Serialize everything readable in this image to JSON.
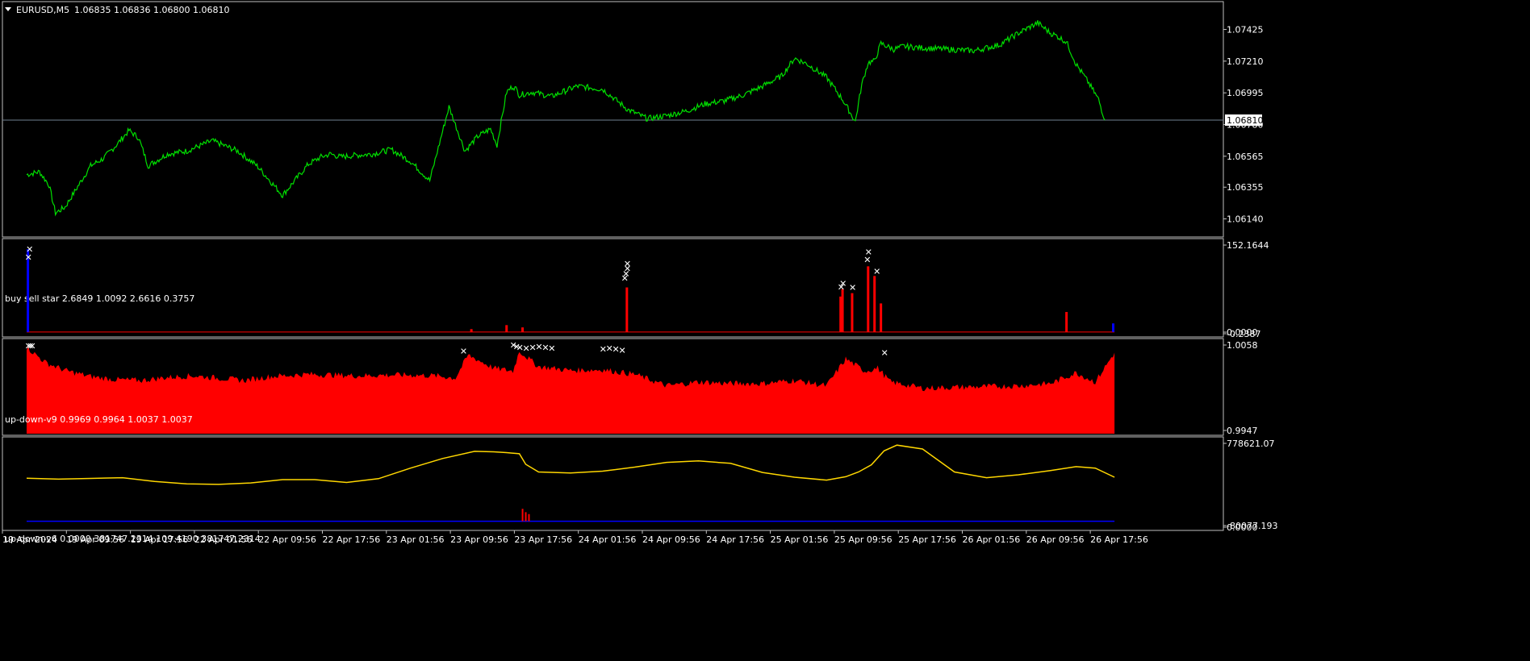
{
  "colors": {
    "background": "#000000",
    "border": "#c0c0c0",
    "text": "#ffffff",
    "price_line": "#00e000",
    "bid_line": "#708090",
    "buy": "#0000ff",
    "sell": "#ff0000",
    "marker": "#ffffff",
    "yellow_line": "#ffd700"
  },
  "icons": {
    "panel_toggle": "triangle-down-icon",
    "signal_marker": "cross-icon"
  },
  "chart_data": [
    {
      "type": "line",
      "title": "EURUSD,M5",
      "ohlc": [
        "1.06835",
        "1.06836",
        "1.06800",
        "1.06810"
      ],
      "last_price_label": "1.06810",
      "y_tick_labels": [
        "1.07425",
        "1.07210",
        "1.06995",
        "1.06780",
        "1.06565",
        "1.06355",
        "1.06140"
      ],
      "ylim": [
        1.0605,
        1.0757
      ],
      "x_tick_labels": [
        "19 Apr 2024",
        "19 Apr 09:56",
        "19 Apr 17:56",
        "22 Apr 01:56",
        "22 Apr 09:56",
        "22 Apr 17:56",
        "23 Apr 01:56",
        "23 Apr 09:56",
        "23 Apr 17:56",
        "24 Apr 01:56",
        "24 Apr 09:56",
        "24 Apr 17:56",
        "25 Apr 01:56",
        "25 Apr 09:56",
        "25 Apr 17:56",
        "26 Apr 01:56",
        "26 Apr 09:56",
        "26 Apr 17:56"
      ],
      "xlim": [
        0,
        17
      ],
      "series": [
        {
          "x": [
            0,
            0.2,
            0.35,
            0.45,
            0.6,
            0.8,
            1.0,
            1.2,
            1.4,
            1.6,
            1.75,
            1.9,
            2.05,
            2.2,
            2.5,
            2.9,
            3.3,
            3.6,
            4.0,
            4.4,
            4.6,
            4.75,
            4.9,
            5.1,
            5.4,
            5.7,
            6.0,
            6.3,
            6.6,
            6.85,
            6.95,
            7.05,
            7.25,
            7.35,
            7.5,
            7.6,
            7.65,
            7.7,
            7.9,
            8.2,
            8.6,
            9.0,
            9.4,
            9.7,
            10.0,
            10.3,
            10.6,
            10.9,
            11.2,
            11.5,
            11.8,
            12.0,
            12.2,
            12.5,
            12.75,
            12.95,
            13.05,
            13.15,
            13.25,
            13.35,
            13.55,
            13.7,
            14.0,
            14.4,
            14.8,
            15.2,
            15.5,
            15.8,
            16.0,
            16.1,
            16.25,
            16.4,
            16.6,
            16.75,
            16.85
          ],
          "values": [
            1.0644,
            1.0646,
            1.0637,
            1.0618,
            1.0622,
            1.0636,
            1.065,
            1.0655,
            1.0664,
            1.0674,
            1.0669,
            1.065,
            1.0654,
            1.0658,
            1.066,
            1.0667,
            1.066,
            1.065,
            1.063,
            1.0651,
            1.0656,
            1.0658,
            1.0656,
            1.0657,
            1.0658,
            1.0661,
            1.0653,
            1.064,
            1.069,
            1.066,
            1.0665,
            1.067,
            1.0675,
            1.0664,
            1.07,
            1.0704,
            1.0702,
            1.0698,
            1.07,
            1.0697,
            1.0704,
            1.0702,
            1.0688,
            1.0682,
            1.0684,
            1.0687,
            1.0692,
            1.0694,
            1.0698,
            1.0704,
            1.0711,
            1.0723,
            1.0719,
            1.071,
            1.0695,
            1.068,
            1.0705,
            1.072,
            1.0721,
            1.0733,
            1.0729,
            1.0731,
            1.073,
            1.0729,
            1.0728,
            1.0732,
            1.074,
            1.0747,
            1.074,
            1.0738,
            1.0734,
            1.0719,
            1.0706,
            1.0695,
            1.0681
          ]
        }
      ]
    },
    {
      "type": "bar",
      "title": "buy sell star",
      "values_text": [
        "2.6849",
        "1.0092",
        "2.6616",
        "0.3757"
      ],
      "y_tick_labels": [
        "152.1644",
        "0.0000",
        "-0.2387"
      ],
      "ylim": [
        -0.2387,
        152.1644
      ],
      "spikes": [
        {
          "x": 0.02,
          "value": 145,
          "side": "buy"
        },
        {
          "x": 6.95,
          "value": 5,
          "side": "sell"
        },
        {
          "x": 7.5,
          "value": 12,
          "side": "sell"
        },
        {
          "x": 7.75,
          "value": 8,
          "side": "sell"
        },
        {
          "x": 9.38,
          "value": 78,
          "side": "sell"
        },
        {
          "x": 12.72,
          "value": 62,
          "side": "sell"
        },
        {
          "x": 12.75,
          "value": 75,
          "side": "sell"
        },
        {
          "x": 12.9,
          "value": 68,
          "side": "sell"
        },
        {
          "x": 13.15,
          "value": 115,
          "side": "sell"
        },
        {
          "x": 13.25,
          "value": 98,
          "side": "sell"
        },
        {
          "x": 13.35,
          "value": 50,
          "side": "sell"
        },
        {
          "x": 16.25,
          "value": 35,
          "side": "sell"
        },
        {
          "x": 16.98,
          "value": 15,
          "side": "buy"
        }
      ],
      "markers": [
        {
          "x": 0.04,
          "value": 145
        },
        {
          "x": 0.02,
          "value": 131
        },
        {
          "x": 9.38,
          "value": 120
        },
        {
          "x": 9.38,
          "value": 111
        },
        {
          "x": 9.36,
          "value": 102
        },
        {
          "x": 9.34,
          "value": 94
        },
        {
          "x": 12.75,
          "value": 85
        },
        {
          "x": 12.72,
          "value": 79
        },
        {
          "x": 12.9,
          "value": 78
        },
        {
          "x": 13.15,
          "value": 140
        },
        {
          "x": 13.13,
          "value": 127
        },
        {
          "x": 13.28,
          "value": 106
        }
      ]
    },
    {
      "type": "area",
      "title": "up-down-v9",
      "values_text": [
        "0.9969",
        "0.9964",
        "1.0037",
        "1.0037"
      ],
      "y_tick_labels": [
        "1.0058",
        "0.9947"
      ],
      "ylim": [
        0.9947,
        1.0058
      ],
      "series": [
        {
          "name": "buy",
          "x": [
            0,
            0.3,
            0.6,
            1.0,
            1.4,
            1.8,
            2.2,
            2.6,
            3.0,
            3.4,
            3.8,
            4.4,
            4.8,
            5.2,
            5.6,
            6.0,
            6.4,
            6.7,
            6.9,
            7.3,
            7.6,
            7.7,
            8.0,
            8.5,
            9.0,
            9.5,
            10.0,
            10.5,
            11.0,
            11.5,
            12.0,
            12.5,
            12.8,
            13.1,
            13.3,
            13.5,
            14.0,
            14.5,
            15.0,
            15.5,
            16.0,
            16.4,
            16.7,
            17.0
          ],
          "values": [
            1.0055,
            1.0035,
            1.0025,
            1.0017,
            1.0013,
            1.001,
            1.0016,
            1.0018,
            1.0008,
            1.0008,
            1.001,
            1.002,
            1.001,
            1.0005,
            1.0004,
            1.0005,
            1.0004,
            1.0006,
            1.0045,
            1.0028,
            1.0024,
            1.005,
            1.003,
            1.0025,
            1.0026,
            1.002,
            1.0,
            1.0001,
            1.0004,
            1.0006,
            1.0005,
            1.0003,
            1.004,
            1.0024,
            1.0028,
            1.001,
            1.0002,
            1.0003,
            1.0004,
            1.0005,
            1.0008,
            1.0022,
            1.001,
            1.0048
          ]
        },
        {
          "name": "sell",
          "x": [
            0,
            0.3,
            0.6,
            1.0,
            1.4,
            1.8,
            2.2,
            2.6,
            3.0,
            3.4,
            3.8,
            4.4,
            4.8,
            5.2,
            5.6,
            6.0,
            6.4,
            6.7,
            6.9,
            7.3,
            7.6,
            7.7,
            8.0,
            8.5,
            9.0,
            9.5,
            10.0,
            10.5,
            11.0,
            11.5,
            12.0,
            12.5,
            12.8,
            13.1,
            13.3,
            13.5,
            14.0,
            14.5,
            15.0,
            15.5,
            16.0,
            16.4,
            16.7,
            17.0
          ],
          "values": [
            0.9947,
            0.9947,
            0.9947,
            0.9947,
            0.999,
            0.9992,
            0.9992,
            0.9993,
            0.9995,
            0.9992,
            0.9997,
            0.9999,
            0.9999,
            0.9998,
            0.9999,
            0.9999,
            0.9998,
            0.9995,
            0.9985,
            0.999,
            0.9988,
            0.9955,
            0.995,
            0.9952,
            0.9955,
            0.9958,
            0.9985,
            0.999,
            0.9988,
            0.9988,
            0.9992,
            0.9985,
            0.997,
            0.999,
            0.9992,
            0.9975,
            0.998,
            0.9982,
            0.998,
            0.9978,
            0.997,
            0.996,
            0.998,
            0.9947
          ]
        }
      ],
      "markers": [
        {
          "x": 0.02,
          "value": 1.0057
        },
        {
          "x": 0.05,
          "value": 1.0057
        },
        {
          "x": 0.08,
          "value": 1.0057
        },
        {
          "x": 6.82,
          "value": 1.005
        },
        {
          "x": 7.6,
          "value": 1.0058
        },
        {
          "x": 7.65,
          "value": 1.0056
        },
        {
          "x": 7.7,
          "value": 1.0055
        },
        {
          "x": 7.8,
          "value": 1.0054
        },
        {
          "x": 7.9,
          "value": 1.0055
        },
        {
          "x": 8.0,
          "value": 1.0056
        },
        {
          "x": 8.1,
          "value": 1.0055
        },
        {
          "x": 8.2,
          "value": 1.0054
        },
        {
          "x": 9.0,
          "value": 1.0053
        },
        {
          "x": 9.1,
          "value": 1.0054
        },
        {
          "x": 9.2,
          "value": 1.0053
        },
        {
          "x": 9.3,
          "value": 1.0051
        },
        {
          "x": 13.4,
          "value": 1.0048
        }
      ]
    },
    {
      "type": "line",
      "title": "up-down-v6",
      "values_text": [
        "0.0000",
        "381747.2314",
        "109.4190",
        "381747.2314"
      ],
      "y_tick_labels": [
        "778621.07",
        "-80077.193",
        "0.0000"
      ],
      "ylim": [
        -80077.193,
        778621.07
      ],
      "series": [
        {
          "name": "yellow",
          "x": [
            0,
            0.5,
            1.0,
            1.5,
            2.0,
            2.5,
            3.0,
            3.5,
            4.0,
            4.5,
            5.0,
            5.5,
            6.0,
            6.5,
            7.0,
            7.3,
            7.5,
            7.7,
            7.8,
            8.0,
            8.5,
            9.0,
            9.5,
            10.0,
            10.5,
            11.0,
            11.5,
            12.0,
            12.5,
            12.8,
            13.0,
            13.2,
            13.4,
            13.6,
            14.0,
            14.5,
            15.0,
            15.5,
            16.0,
            16.4,
            16.7,
            17.0
          ],
          "values": [
            415000,
            405000,
            412000,
            420000,
            380000,
            355000,
            350000,
            365000,
            400000,
            400000,
            370000,
            410000,
            520000,
            620000,
            695000,
            690000,
            682000,
            670000,
            560000,
            480000,
            470000,
            488000,
            530000,
            580000,
            595000,
            570000,
            475000,
            425000,
            395000,
            430000,
            480000,
            555000,
            700000,
            760000,
            720000,
            480000,
            420000,
            450000,
            495000,
            535000,
            520000,
            425000
          ]
        },
        {
          "name": "blue",
          "x": [
            0,
            17
          ],
          "values": [
            -35000,
            -35000
          ]
        }
      ],
      "spikes": [
        {
          "x": 7.75,
          "value": 95000
        },
        {
          "x": 7.8,
          "value": 60000
        },
        {
          "x": 7.85,
          "value": 40000
        }
      ]
    }
  ]
}
